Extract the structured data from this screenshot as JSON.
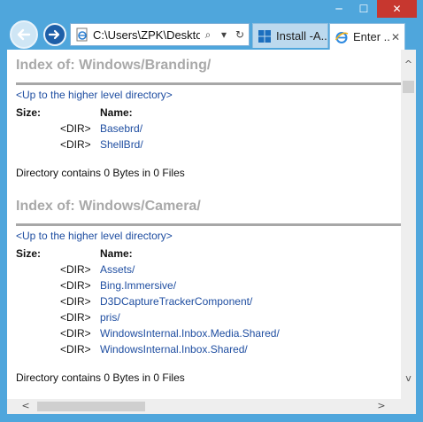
{
  "window": {
    "minimize_glyph": "─",
    "maximize_glyph": "☐",
    "close_glyph": "✕"
  },
  "address_bar": {
    "url": "C:\\Users\\ZPK\\Desktop",
    "search_glyph": "⌕",
    "dropdown_glyph": "▾",
    "refresh_glyph": "↻"
  },
  "tabs": [
    {
      "label": "Install -A...",
      "icon": "windows-logo-icon",
      "active": false
    },
    {
      "label": "Enter ...",
      "icon": "ie-icon",
      "active": true,
      "close_glyph": "✕"
    }
  ],
  "sections": [
    {
      "title": "Index of: Windows/Branding/",
      "up_link": "<Up to the higher level directory>",
      "header_size": "Size:",
      "header_name": "Name:",
      "entries": [
        {
          "size": "<DIR>",
          "name": "Basebrd/"
        },
        {
          "size": "<DIR>",
          "name": "ShellBrd/"
        }
      ],
      "summary": "Directory contains 0 Bytes in 0 Files"
    },
    {
      "title": "Index of: Windows/Camera/",
      "up_link": "<Up to the higher level directory>",
      "header_size": "Size:",
      "header_name": "Name:",
      "entries": [
        {
          "size": "<DIR>",
          "name": "Assets/"
        },
        {
          "size": "<DIR>",
          "name": "Bing.Immersive/"
        },
        {
          "size": "<DIR>",
          "name": "D3DCaptureTrackerComponent/"
        },
        {
          "size": "<DIR>",
          "name": "pris/"
        },
        {
          "size": "<DIR>",
          "name": "WindowsInternal.Inbox.Media.Shared/"
        },
        {
          "size": "<DIR>",
          "name": "WindowsInternal.Inbox.Shared/"
        }
      ],
      "summary": "Directory contains 0 Bytes in 0 Files"
    }
  ],
  "scrollbars": {
    "up": "^",
    "down": "v",
    "left": "<",
    "right": ">"
  },
  "colors": {
    "chrome": "#4fa6dc",
    "close_button": "#c7372f",
    "link": "#1f4ea1",
    "heading": "#a9a9a9"
  }
}
